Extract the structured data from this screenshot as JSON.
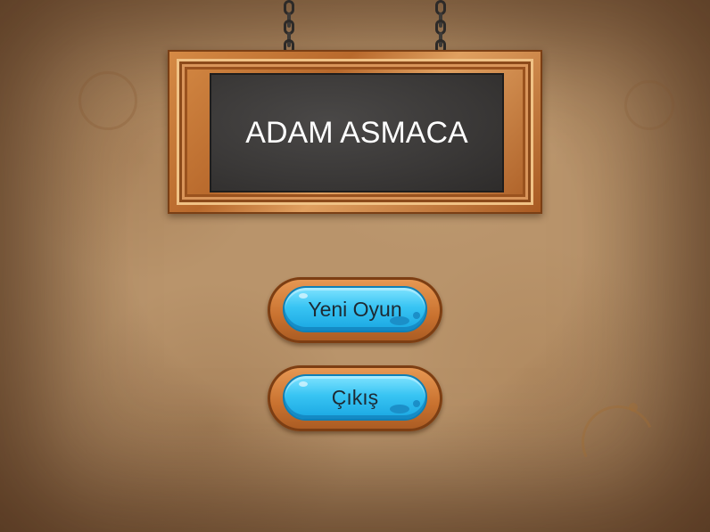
{
  "sign": {
    "title": "ADAM ASMACA"
  },
  "menu": {
    "new_game_label": "Yeni Oyun",
    "exit_label": "Çıkış"
  },
  "colors": {
    "background": "#b9946b",
    "frame_wood": "#c8712f",
    "chalkboard": "#3a3837",
    "button_face": "#38c4f3",
    "button_text": "#1e2a33",
    "title_text": "#ffffff"
  },
  "icons": {
    "chain": "chain-icon"
  }
}
